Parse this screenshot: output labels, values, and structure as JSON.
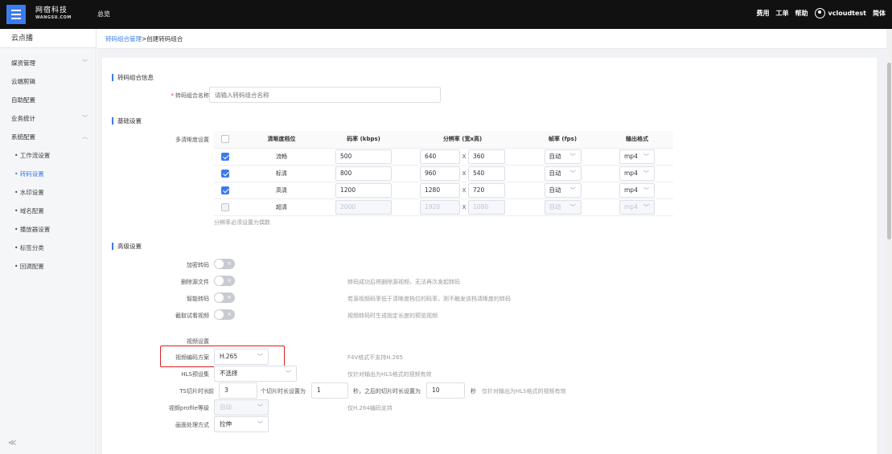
{
  "topbar": {
    "logo_cn": "网宿科技",
    "logo_en": "WANGSU.COM",
    "home": "总览",
    "fees": "费用",
    "tickets": "工单",
    "help": "帮助",
    "username": "vcloudtest",
    "lang": "简体"
  },
  "sidebar": {
    "title": "云点播",
    "items": [
      {
        "label": "媒资管理",
        "chevron": "﹀"
      },
      {
        "label": "云端剪辑",
        "chevron": ""
      },
      {
        "label": "自助配置",
        "chevron": ""
      },
      {
        "label": "业务统计",
        "chevron": "﹀"
      },
      {
        "label": "系统配置",
        "chevron": "︿"
      }
    ],
    "subitems": [
      {
        "label": "• 工作流设置"
      },
      {
        "label": "• 转码设置"
      },
      {
        "label": "• 水印设置"
      },
      {
        "label": "• 域名配置"
      },
      {
        "label": "• 播放器设置"
      },
      {
        "label": "• 标签分类"
      },
      {
        "label": "• 回调配置"
      }
    ],
    "collapse": "≪"
  },
  "breadcrumb": {
    "parent": "转码组合管理",
    "sep": ">",
    "current": "创建转码组合"
  },
  "sections": {
    "basic_info": "转码组合信息",
    "base_settings": "基础设置",
    "advanced": "高级设置"
  },
  "combo_name": {
    "required": "*",
    "label": "转码组合名称",
    "placeholder": "请输入转码组合名称"
  },
  "multi_def": {
    "label": "多清晰度设置",
    "headers": [
      "",
      "清晰度档位",
      "码率 (kbps)",
      "分辨率 (宽x高)",
      "帧率 (fps)",
      "输出格式"
    ],
    "rows": [
      {
        "checked": true,
        "disabled": false,
        "name": "流畅",
        "bitrate": "500",
        "width": "640",
        "height": "360",
        "fps": "自动",
        "format": "mp4"
      },
      {
        "checked": true,
        "disabled": false,
        "name": "标清",
        "bitrate": "800",
        "width": "960",
        "height": "540",
        "fps": "自动",
        "format": "mp4"
      },
      {
        "checked": true,
        "disabled": false,
        "name": "高清",
        "bitrate": "1200",
        "width": "1280",
        "height": "720",
        "fps": "自动",
        "format": "mp4"
      },
      {
        "checked": false,
        "disabled": true,
        "name": "超清",
        "bitrate": "2000",
        "width": "1920",
        "height": "1080",
        "fps": "自动",
        "format": "mp4"
      }
    ],
    "x_mark": "X",
    "hint": "分辨率必须设置为偶数"
  },
  "advanced": {
    "toggles": [
      {
        "label": "加密转码",
        "hint": ""
      },
      {
        "label": "删除源文件",
        "hint": "转码成功后将删除源视频，无法再次发起转码"
      },
      {
        "label": "智能转码",
        "hint": "若源视频码率低于清晰度档位的码率，则不触发该档清晰度的转码"
      },
      {
        "label": "截取试看视频",
        "hint": "视频转码时生成指定长度的预览视频"
      }
    ],
    "toggle_off_text": "×",
    "video_settings": "视频设置",
    "codec": {
      "label": "视频编码方案",
      "value": "H.265",
      "hint": "F4V格式不支持H.265"
    },
    "hls": {
      "label": "HLS预设集",
      "value": "不选择",
      "hint": "仅针对输出为HLS格式的视频有效"
    },
    "ts": {
      "label": "TS切片时长",
      "prefix": "前",
      "count": "3",
      "mid1": "个切片时长设置为",
      "first_len": "1",
      "mid2": "秒，之后的切片时长设置为",
      "rest_len": "10",
      "unit": "秒",
      "hint": "仅针对输出为HLS格式的视频有效"
    },
    "profile": {
      "label": "视频profile等级",
      "value": "自动",
      "hint": "仅H.264编码支持"
    },
    "scaling": {
      "label": "画面处理方式",
      "value": "拉伸"
    }
  },
  "colors": {
    "accent": "#3b7bf0",
    "highlight": "#e02020",
    "topbar": "#111111"
  }
}
